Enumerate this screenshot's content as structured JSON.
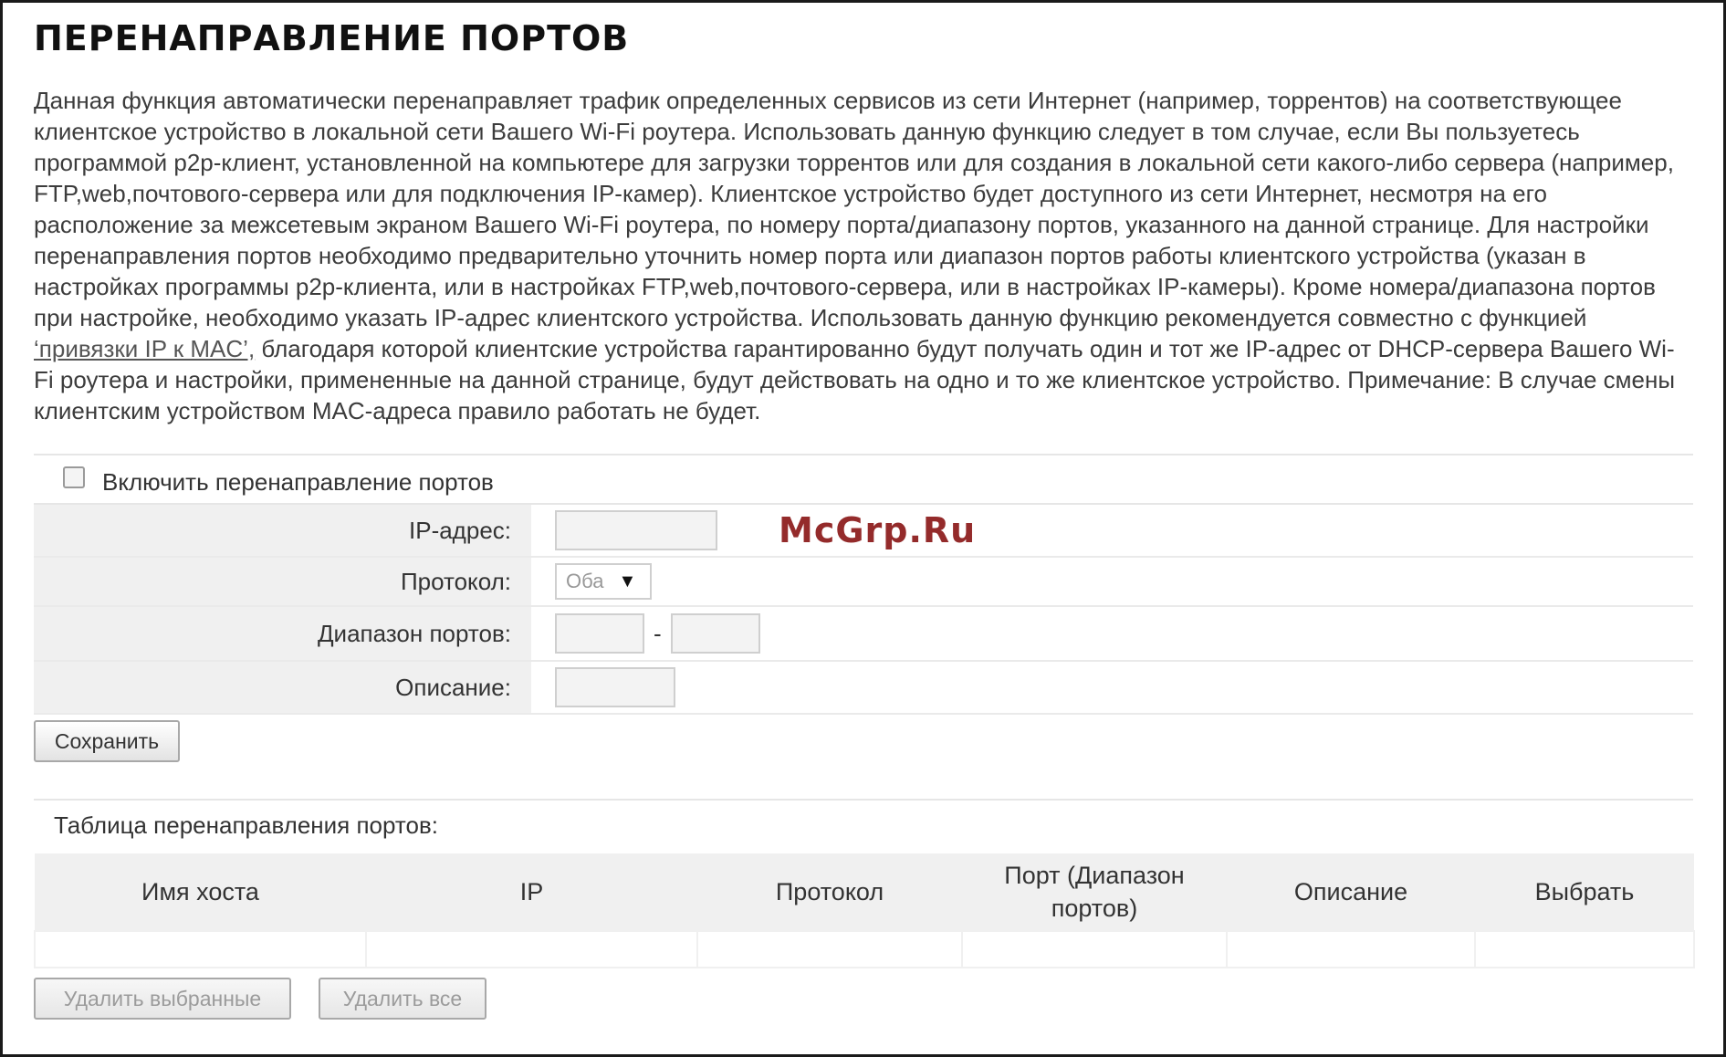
{
  "page": {
    "title": "ПЕРЕНАПРАВЛЕНИЕ ПОРТОВ",
    "description_part1": "Данная функция автоматически перенаправляет трафик определенных сервисов из сети Интернет (например, торрентов) на соответствующее клиентское устройство в локальной сети Вашего Wi-Fi роутера. Использовать данную функцию следует в том случае, если Вы пользуетесь программой p2p-клиент, установленной на компьютере для загрузки торрентов или для создания в локальной сети какого-либо сервера (например, FTP,web,почтового-сервера или для подключения IP-камер). Клиентское устройство будет доступного из сети Интернет, несмотря на его расположение за межсетевым экраном Вашего Wi-Fi роутера, по номеру порта/диапазону портов, указанного на данной странице. Для настройки перенаправления портов необходимо предварительно уточнить номер порта или диапазон портов работы клиентского устройства (указан в настройках программы p2p-клиента, или в настройках FTP,web,почтового-сервера, или в настройках IP-камеры). Кроме номера/диапазона портов при настройке, необходимо указать IP-адрес клиентского устройства. Использовать данную функцию рекомендуется совместно с функцией ",
    "description_link": "‘привязки IP к MAC’,",
    "description_part2": " благодаря которой клиентские устройства гарантированно будут получать один и тот же IP-адрес от DHCP-сервера Вашего Wi-Fi роутера и настройки, примененные на данной странице, будут действовать на одно и то же клиентское устройство. Примечание: В случае смены клиентским устройством MAC-адреса правило работать не будет."
  },
  "form": {
    "enable_label": "Включить перенаправление портов",
    "enable_checked": false,
    "ip_label": "IP-адрес:",
    "ip_value": "",
    "protocol_label": "Протокол:",
    "protocol_value": "Оба",
    "port_range_label": "Диапазон портов:",
    "port_from_value": "",
    "port_separator": "-",
    "port_to_value": "",
    "description_label": "Описание:",
    "description_value": "",
    "save_label": "Сохранить"
  },
  "table": {
    "caption": "Таблица перенаправления портов:",
    "headers": [
      "Имя хоста",
      "IP",
      "Протокол",
      "Порт (Диапазон портов)",
      "Описание",
      "Выбрать"
    ],
    "rows": []
  },
  "actions": {
    "delete_selected_label": "Удалить выбранные",
    "delete_all_label": "Удалить все"
  },
  "watermark": "McGrp.Ru"
}
